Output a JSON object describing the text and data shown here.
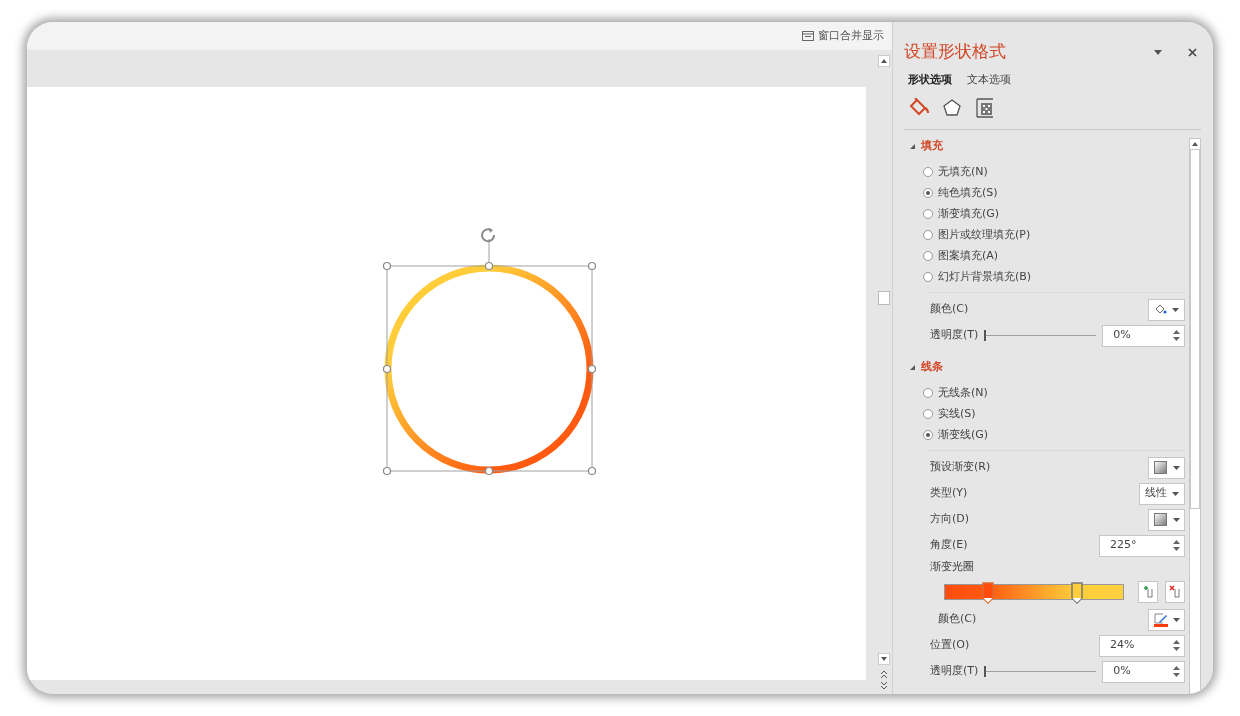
{
  "top_bar": {
    "merge_windows_label": "窗口合并显示"
  },
  "pane": {
    "title": "设置形状格式",
    "tabs": [
      {
        "label": "形状选项",
        "selected": true
      },
      {
        "label": "文本选项",
        "selected": false
      }
    ],
    "icon_tabs": [
      {
        "kind": "fill",
        "selected": true
      },
      {
        "kind": "effects",
        "selected": false
      },
      {
        "kind": "size",
        "selected": false
      }
    ],
    "sections": [
      {
        "title": "填充",
        "expanded": true,
        "options": [
          {
            "label": "无填充(N)",
            "selected": false
          },
          {
            "label": "纯色填充(S)",
            "selected": true
          },
          {
            "label": "渐变填充(G)",
            "selected": false
          },
          {
            "label": "图片或纹理填充(P)",
            "selected": false
          },
          {
            "label": "图案填充(A)",
            "selected": false
          },
          {
            "label": "幻灯片背景填充(B)",
            "selected": false
          }
        ],
        "properties": [
          {
            "kind": "fill_color_button",
            "label": "颜色(C)"
          },
          {
            "kind": "slider_spin",
            "label": "透明度(T)",
            "level": 0,
            "value": "0%"
          }
        ]
      },
      {
        "title": "线条",
        "expanded": true,
        "options": [
          {
            "label": "无线条(N)",
            "selected": false
          },
          {
            "label": "实线(S)",
            "selected": false
          },
          {
            "label": "渐变线(G)",
            "selected": true
          }
        ],
        "properties": [
          {
            "kind": "swatch_dropdown",
            "label": "预设渐变(R)"
          },
          {
            "kind": "text_dropdown",
            "label": "类型(Y)",
            "value": "线性"
          },
          {
            "kind": "swatch_dropdown",
            "label": "方向(D)"
          },
          {
            "kind": "spin",
            "label": "角度(E)",
            "value": "225°"
          },
          {
            "kind": "gradient_stops",
            "label": "渐变光圈",
            "stops": [
              {
                "level": 0.24,
                "selected": true
              },
              {
                "level": 0.74,
                "selected": false
              }
            ]
          },
          {
            "kind": "pen_color_button",
            "label": "颜色(C)"
          },
          {
            "kind": "spin",
            "label": "位置(O)",
            "value": "24%"
          },
          {
            "kind": "slider_spin",
            "label": "透明度(T)",
            "level": 0,
            "value": "0%"
          }
        ]
      }
    ]
  }
}
